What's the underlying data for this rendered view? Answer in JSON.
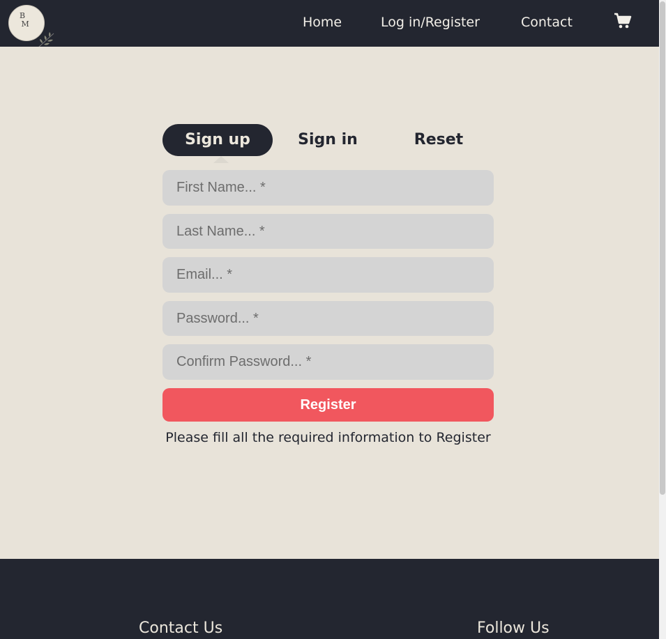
{
  "nav": {
    "logo_text": "BM",
    "links": [
      "Home",
      "Log in/Register",
      "Contact"
    ]
  },
  "icons": {
    "cart": "shopping-cart-icon",
    "logo": "brand-logo"
  },
  "tabs": [
    "Sign up",
    "Sign in",
    "Reset"
  ],
  "form": {
    "fields": [
      {
        "placeholder": "First Name... *",
        "value": ""
      },
      {
        "placeholder": "Last Name... *",
        "value": ""
      },
      {
        "placeholder": "Email... *",
        "value": ""
      },
      {
        "placeholder": "Password... *",
        "value": ""
      },
      {
        "placeholder": "Confirm Password... *",
        "value": ""
      }
    ],
    "submit_label": "Register",
    "hint": "Please fill all the required information to Register"
  },
  "footer": {
    "contact_heading": "Contact Us",
    "follow_heading": "Follow Us"
  },
  "colors": {
    "dark": "#232630",
    "cream": "#e8e3d9",
    "accent": "#f1575e",
    "input": "#d4d4d4"
  }
}
